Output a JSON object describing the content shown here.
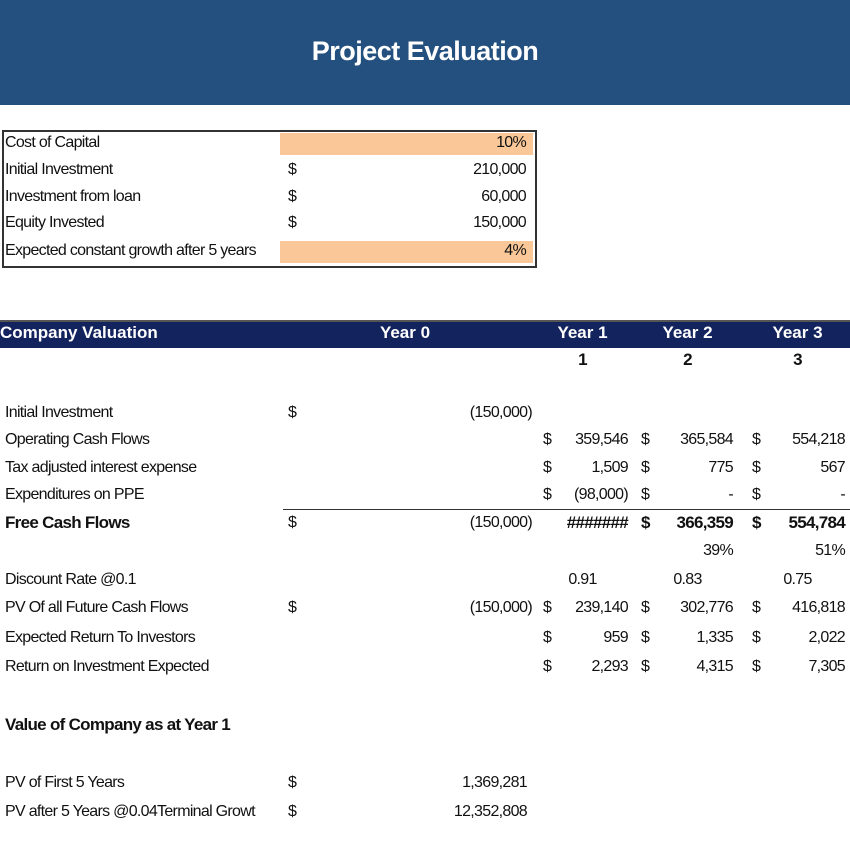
{
  "title": "Project Evaluation",
  "inputs": [
    {
      "label": "Cost of Capital",
      "currency": "",
      "value": "10%",
      "highlight": true
    },
    {
      "label": "Initial Investment",
      "currency": "$",
      "value": "210,000",
      "highlight": false
    },
    {
      "label": "Investment from loan",
      "currency": "$",
      "value": "60,000",
      "highlight": false
    },
    {
      "label": "Equity Invested",
      "currency": "$",
      "value": "150,000",
      "highlight": false
    },
    {
      "label": "Expected constant growth after 5 years",
      "currency": "",
      "value": "4%",
      "highlight": true
    }
  ],
  "valuation": {
    "headers": [
      "Company Valuation",
      "Year 0",
      "Year 1",
      "Year 2",
      "Year 3"
    ],
    "period_numbers": [
      "1",
      "2",
      "3"
    ],
    "rows": [
      {
        "label": "Initial Investment",
        "d0": "$",
        "y0": "(150,000)",
        "d1": "",
        "y1": "",
        "d2": "",
        "y2": "",
        "d3": "",
        "y3": ""
      },
      {
        "label": "Operating Cash Flows",
        "d0": "",
        "y0": "",
        "d1": "$",
        "y1": "359,546",
        "d2": "$",
        "y2": "365,584",
        "d3": "$",
        "y3": "554,218"
      },
      {
        "label": "Tax adjusted interest expense",
        "d0": "",
        "y0": "",
        "d1": "$",
        "y1": "1,509",
        "d2": "$",
        "y2": "775",
        "d3": "$",
        "y3": "567"
      },
      {
        "label": "Expenditures on PPE",
        "d0": "",
        "y0": "",
        "d1": "$",
        "y1": "(98,000)",
        "d2": "$",
        "y2": "-",
        "d3": "$",
        "y3": "-"
      },
      {
        "label": "Free Cash Flows",
        "d0": "$",
        "y0": "(150,000)",
        "d1": "",
        "y1": "#######",
        "d2": "$",
        "y2": "366,359",
        "d3": "$",
        "y3": "554,784"
      },
      {
        "label": "",
        "d0": "",
        "y0": "",
        "d1": "",
        "y1": "",
        "d2": "",
        "y2": "39%",
        "d3": "",
        "y3": "51%"
      },
      {
        "label": "Discount Rate @0.1",
        "d0": "",
        "y0": "",
        "d1": "",
        "y1": "0.91",
        "d2": "",
        "y2": "0.83",
        "d3": "",
        "y3": "0.75"
      },
      {
        "label": "PV Of all Future Cash Flows",
        "d0": "$",
        "y0": "(150,000)",
        "d1": "$",
        "y1": "239,140",
        "d2": "$",
        "y2": "302,776",
        "d3": "$",
        "y3": "416,818"
      },
      {
        "label": "Expected Return To Investors",
        "d0": "",
        "y0": "",
        "d1": "$",
        "y1": "959",
        "d2": "$",
        "y2": "1,335",
        "d3": "$",
        "y3": "2,022"
      },
      {
        "label": "Return on Investment Expected",
        "d0": "",
        "y0": "",
        "d1": "$",
        "y1": "2,293",
        "d2": "$",
        "y2": "4,315",
        "d3": "$",
        "y3": "7,305"
      }
    ]
  },
  "company_value": {
    "title": "Value of Company as at Year 1",
    "rows": [
      {
        "label": "PV of First 5 Years",
        "currency": "$",
        "value": "1,369,281"
      },
      {
        "label": "PV after 5 Years @0.04Terminal Growt",
        "currency": "$",
        "value": "12,352,808"
      }
    ]
  },
  "colors": {
    "banner": "#24507f",
    "header_bar": "#13235e",
    "input_highlight": "#fac898"
  }
}
